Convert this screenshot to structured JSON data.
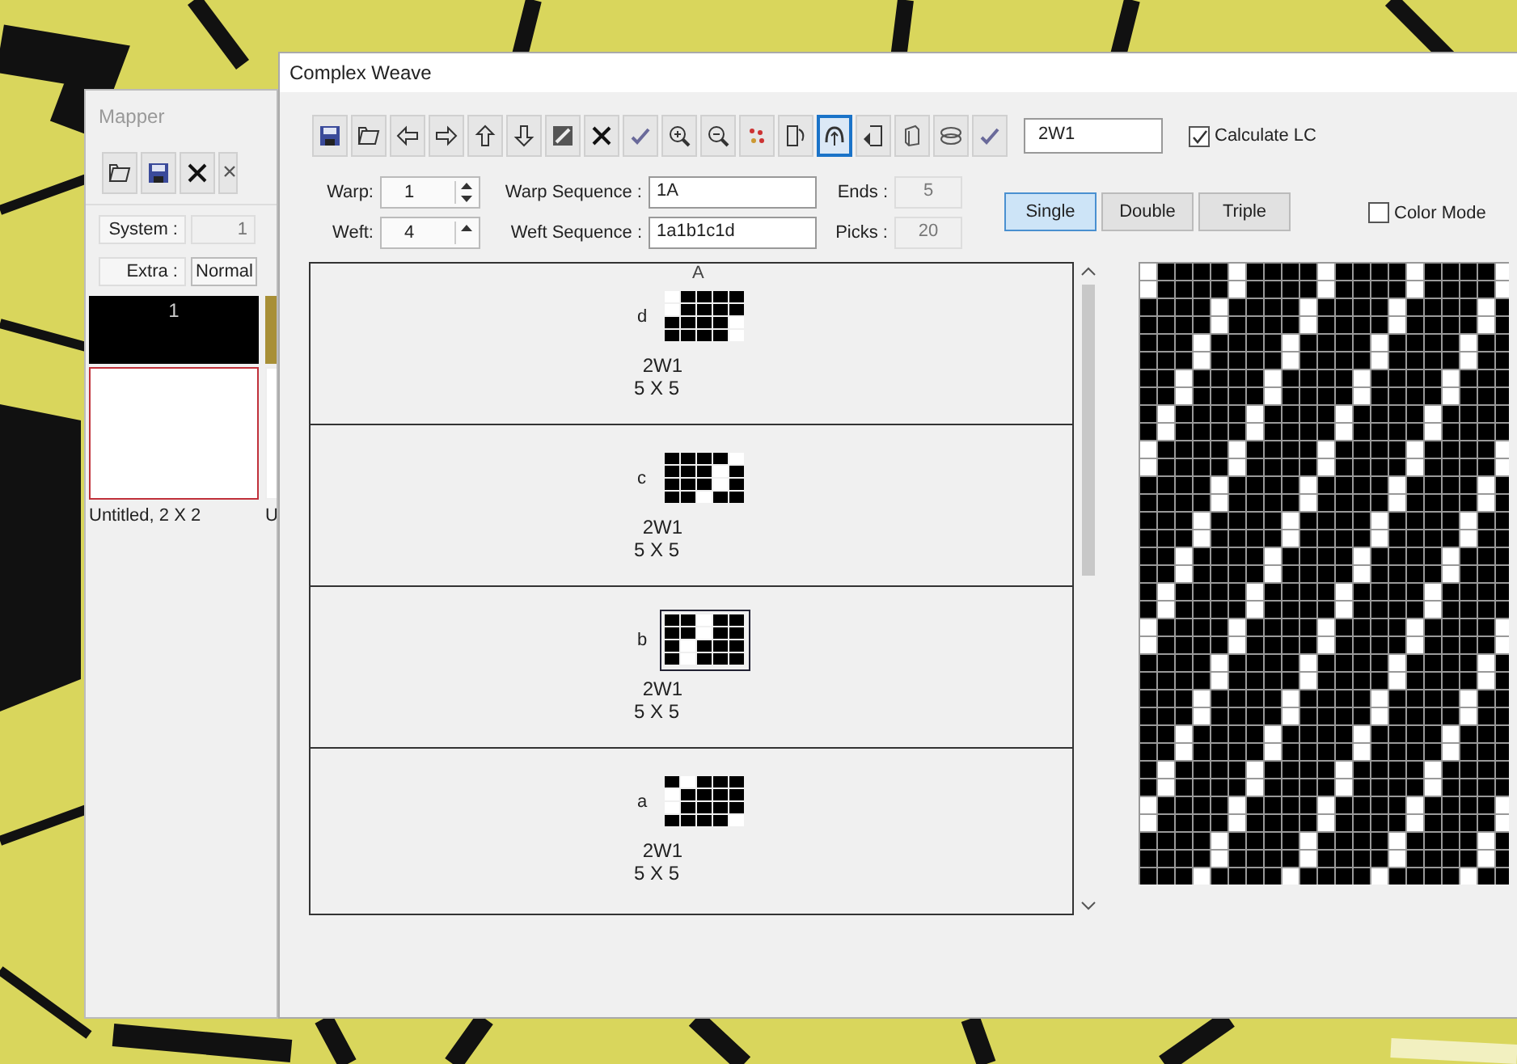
{
  "mapper": {
    "title": "Mapper",
    "system_label": "System :",
    "system_value": "1",
    "extra_label": "Extra :",
    "extra_value": "Normal",
    "thumbnails": [
      {
        "number": "1",
        "caption": "Untitled, 2 X 2",
        "selected": true
      },
      {
        "caption": "U",
        "selected": false
      }
    ]
  },
  "window": {
    "title": "Complex Weave"
  },
  "toolbar": [
    {
      "selected": false
    },
    {
      "selected": false
    },
    {
      "selected": false
    },
    {
      "selected": false
    },
    {
      "selected": false
    },
    {
      "selected": false
    },
    {
      "selected": false
    },
    {
      "selected": false
    },
    {
      "selected": false
    },
    {
      "selected": false
    },
    {
      "selected": false
    },
    {
      "selected": false
    },
    {
      "selected": false
    },
    {
      "selected": true
    },
    {
      "selected": false
    },
    {
      "selected": false
    },
    {
      "selected": false
    },
    {
      "selected": false
    }
  ],
  "pattern_name": "2W1",
  "calculate_lcm": {
    "label": "Calculate LC",
    "checked": true
  },
  "warp": {
    "label": "Warp:",
    "value": "1"
  },
  "warp_sequence": {
    "label": "Warp Sequence :",
    "value": "1A"
  },
  "ends": {
    "label": "Ends :",
    "value": "5"
  },
  "weft": {
    "label": "Weft:",
    "value": "4"
  },
  "weft_sequence": {
    "label": "Weft Sequence :",
    "value": "1a1b1c1d"
  },
  "picks": {
    "label": "Picks :",
    "value": "20"
  },
  "layer_modes": [
    {
      "label": "Single",
      "selected": true
    },
    {
      "label": "Double",
      "selected": false
    },
    {
      "label": "Triple",
      "selected": false
    }
  ],
  "color_mode": {
    "label": "Color Mode",
    "checked": false
  },
  "column_header": "A",
  "layers": [
    {
      "label": "d",
      "name": "2W1",
      "size": "5 X 5",
      "selected": false
    },
    {
      "label": "c",
      "name": "2W1",
      "size": "5 X 5",
      "selected": false
    },
    {
      "label": "b",
      "name": "2W1",
      "size": "5 X 5",
      "selected": true
    },
    {
      "label": "a",
      "name": "2W1",
      "size": "5 X 5",
      "selected": false
    }
  ]
}
